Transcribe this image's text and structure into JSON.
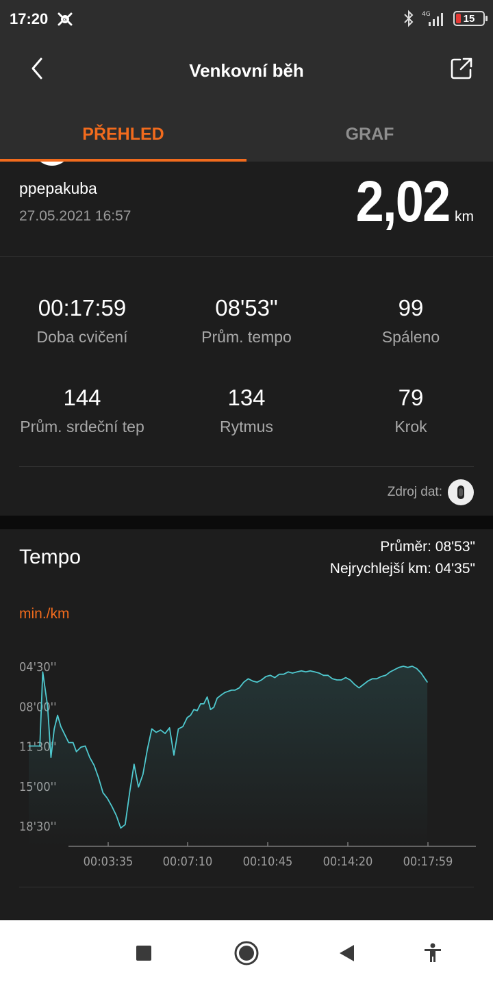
{
  "status_bar": {
    "time": "17:20",
    "network": "4G",
    "battery": "15"
  },
  "header": {
    "title": "Venkovní běh"
  },
  "tabs": [
    {
      "label": "PŘEHLED",
      "active": true
    },
    {
      "label": "GRAF",
      "active": false
    }
  ],
  "profile": {
    "username": "ppepakuba",
    "datetime": "27.05.2021 16:57",
    "distance_value": "2,02",
    "distance_unit": "km"
  },
  "stats": [
    {
      "value": "00:17:59",
      "label": "Doba cvičení"
    },
    {
      "value": "08'53\"",
      "label": "Prům. tempo"
    },
    {
      "value": "99",
      "label": "Spáleno"
    },
    {
      "value": "144",
      "label": "Prům. srdeční tep"
    },
    {
      "value": "134",
      "label": "Rytmus"
    },
    {
      "value": "79",
      "label": "Krok"
    }
  ],
  "source": {
    "label": "Zdroj dat:"
  },
  "tempo": {
    "title": "Tempo",
    "average": "Průměr: 08'53\"",
    "fastest": "Nejrychlejší km: 04'35\"",
    "unit": "min./km"
  },
  "chart_data": {
    "type": "area",
    "ylabel": "min./km",
    "y_ticks": [
      "04'30''",
      "08'00''",
      "11'30''",
      "15'00''",
      "18'30''"
    ],
    "x_ticks": [
      "00:03:35",
      "00:07:10",
      "00:10:45",
      "00:14:20",
      "00:17:59"
    ],
    "y_inverted": true,
    "line_color": "#4fc9cf",
    "series": [
      {
        "x_min": [
          0,
          0.5,
          0.63,
          0.85,
          1.0,
          1.15,
          1.3,
          1.45,
          1.6,
          1.8,
          2.0,
          2.15,
          2.35,
          2.55,
          2.75,
          2.95,
          3.15,
          3.35,
          3.55,
          3.75,
          3.95,
          4.15,
          4.35,
          4.55,
          4.75,
          4.95,
          5.15,
          5.35,
          5.55,
          5.75,
          5.95,
          6.15,
          6.35,
          6.55,
          6.75,
          6.95,
          7.15,
          7.3,
          7.45,
          7.6,
          7.75,
          7.9,
          8.05,
          8.2,
          8.35,
          8.5,
          8.7,
          8.85,
          9.0,
          9.15,
          9.3,
          9.5,
          9.7,
          9.9,
          10.1,
          10.3,
          10.5,
          10.7,
          10.9,
          11.1,
          11.3,
          11.5,
          11.7,
          11.9,
          12.1,
          12.3,
          12.5,
          12.7,
          12.9,
          13.1,
          13.3,
          13.5,
          13.7,
          13.9,
          14.1,
          14.3,
          14.5,
          14.7,
          14.9,
          15.1,
          15.3,
          15.5,
          15.7,
          15.9,
          16.1,
          16.3,
          16.5,
          16.7,
          16.9,
          17.1,
          17.3,
          17.5,
          17.7,
          17.98
        ],
        "y_min": [
          11.5,
          11.5,
          5.0,
          8.0,
          12.5,
          10.0,
          8.8,
          9.8,
          10.4,
          11.2,
          11.2,
          12.0,
          11.6,
          11.5,
          12.5,
          13.2,
          14.3,
          15.6,
          16.1,
          16.8,
          17.6,
          18.7,
          18.4,
          15.6,
          13.1,
          15.1,
          14.0,
          11.8,
          10.0,
          10.3,
          10.1,
          10.4,
          9.9,
          12.3,
          10.0,
          9.8,
          9.0,
          8.8,
          8.3,
          8.4,
          7.8,
          7.8,
          7.2,
          8.3,
          8.1,
          7.3,
          7.0,
          6.8,
          6.7,
          6.6,
          6.6,
          6.4,
          5.9,
          5.6,
          5.8,
          5.9,
          5.7,
          5.4,
          5.3,
          5.5,
          5.2,
          5.2,
          5.0,
          5.1,
          5.0,
          4.9,
          5.0,
          4.9,
          5.0,
          5.1,
          5.3,
          5.3,
          5.6,
          5.7,
          5.7,
          5.5,
          5.7,
          6.1,
          6.4,
          6.1,
          5.8,
          5.6,
          5.6,
          5.4,
          5.3,
          5.0,
          4.8,
          4.6,
          4.5,
          4.6,
          4.5,
          4.7,
          5.1,
          5.9
        ]
      }
    ]
  }
}
